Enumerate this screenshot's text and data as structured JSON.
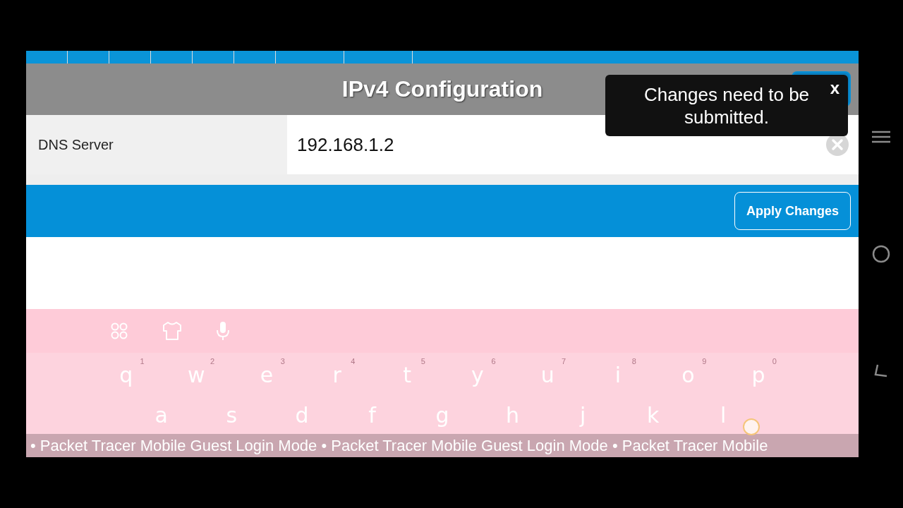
{
  "dialog": {
    "title": "IPv4 Configuration",
    "fields": [
      {
        "label": "DNS Server",
        "value": "192.168.1.2"
      }
    ],
    "apply_button": "Apply Changes"
  },
  "toast": {
    "message": "Changes need to be submitted.",
    "close": "x"
  },
  "keyboard": {
    "rows": [
      [
        {
          "key": "q",
          "hint": "1"
        },
        {
          "key": "w",
          "hint": "2"
        },
        {
          "key": "e",
          "hint": "3"
        },
        {
          "key": "r",
          "hint": "4"
        },
        {
          "key": "t",
          "hint": "5"
        },
        {
          "key": "y",
          "hint": "6"
        },
        {
          "key": "u",
          "hint": "7"
        },
        {
          "key": "i",
          "hint": "8"
        },
        {
          "key": "o",
          "hint": "9"
        },
        {
          "key": "p",
          "hint": "0"
        }
      ],
      [
        {
          "key": "a"
        },
        {
          "key": "s"
        },
        {
          "key": "d"
        },
        {
          "key": "f"
        },
        {
          "key": "g"
        },
        {
          "key": "h"
        },
        {
          "key": "j"
        },
        {
          "key": "k"
        },
        {
          "key": "l"
        }
      ]
    ]
  },
  "banner": "• Packet Tracer Mobile Guest Login Mode • Packet Tracer Mobile Guest Login Mode • Packet Tracer Mobile"
}
